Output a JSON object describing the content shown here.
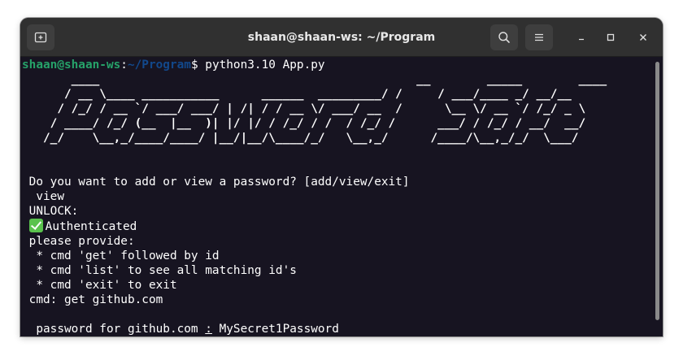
{
  "window": {
    "title": "shaan@shaan-ws: ~/Program"
  },
  "icons": {
    "new_tab": "new-tab-icon",
    "search": "search-icon",
    "menu": "hamburger-menu-icon",
    "minimize": "minimize-icon",
    "maximize": "maximize-icon",
    "close": "close-icon",
    "authenticated": "check-mark-icon"
  },
  "colors": {
    "terminal_background": "#171421",
    "prompt_user": "#26a269",
    "prompt_path": "#12488b",
    "titlebar": "#303030"
  },
  "terminal": {
    "prompt_user": "shaan@shaan-ws",
    "prompt_colon": ":",
    "prompt_path": "~/Program",
    "prompt_symbol": "$ ",
    "command": "python3.10 App.py",
    "banner_lines": [
      "       ____                                             __        _____        ____",
      "      / __ \\____ ___________      ______  _________/ /     / ___/____ _/ __/__",
      "     / /_/ / __ `/ ___/ ___/ | /| / / __ \\/ ___/ __  /      \\__ \\/ __ `/ /_/ _ \\",
      "    / ____/ /_/ (__  |__  )| |/ |/ / /_/ / /  / /_/ /      ___/ / /_/ / __/  __/",
      "   /_/    \\__,_/____/____/ |__/|__/\\____/_/   \\__,_/      /____/\\__,_/_/  \\___/"
    ],
    "question": " Do you want to add or view a password? [add/view/exit]",
    "answer": "  view",
    "unlock": " UNLOCK:",
    "authenticated": "Authenticated",
    "provide": " please provide:",
    "cmd_get": "  * cmd 'get' followed by id",
    "cmd_list": "  * cmd 'list' to see all matching id's",
    "cmd_exit": "  * cmd 'exit' to exit",
    "cmd_entry": " cmd: get github.com",
    "password_label": "  password for github.com ",
    "password_sep": ":",
    "password_value": " MySecret1Password"
  }
}
